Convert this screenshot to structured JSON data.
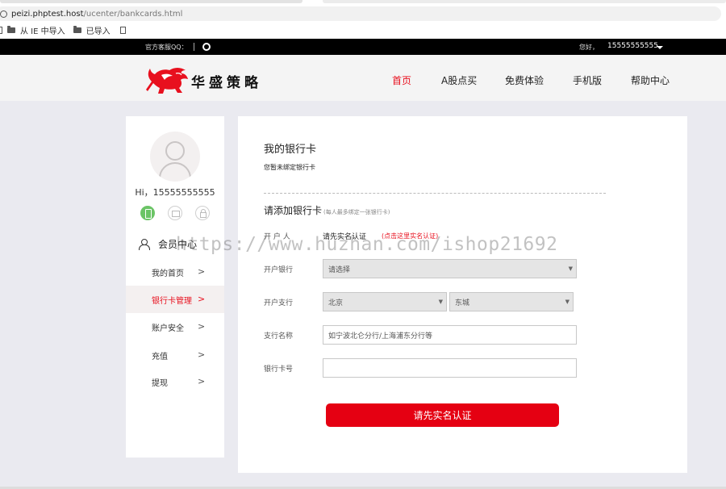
{
  "browser": {
    "url_host": "peizi.phptest.host",
    "url_path": "/ucenter/bankcards.html",
    "bookmarks": [
      "从 IE 中导入",
      "已导入"
    ]
  },
  "topbar": {
    "qq_label": "官方客服QQ：",
    "hello": "您好，",
    "username": "15555555555"
  },
  "header": {
    "brand": "华盛策略",
    "nav": [
      "首页",
      "A股点买",
      "免费体验",
      "手机版",
      "帮助中心"
    ],
    "active_nav": 0
  },
  "sidebar": {
    "greeting": "Hi，15555555555",
    "member_center": "会员中心",
    "menu": [
      {
        "label": "我的首页",
        "chevron": ">"
      },
      {
        "label": "银行卡管理",
        "chevron": ">"
      },
      {
        "label": "账户安全",
        "chevron": ">"
      },
      {
        "label": "充值",
        "chevron": ">"
      },
      {
        "label": "提现",
        "chevron": ">"
      }
    ],
    "active_menu": 1
  },
  "main": {
    "title": "我的银行卡",
    "no_card_text": "您暂未绑定银行卡",
    "add_title": "请添加银行卡",
    "add_hint": "(每人最多绑定一张银行卡)",
    "fields": {
      "owner_label": "开 户 人",
      "owner_value": "请先实名认证",
      "owner_link": "(点击这里实名认证)",
      "bank_label": "开户银行",
      "bank_value": "请选择",
      "branch_label": "开户支行",
      "province_value": "北京",
      "city_value": "东城",
      "branch_name_label": "支行名称",
      "branch_name_placeholder": "如宁波北仑分行/上海浦东分行等",
      "card_no_label": "银行卡号",
      "card_no_value": ""
    },
    "submit_label": "请先实名认证"
  },
  "watermark": "https://www.huzhan.com/ishop21692",
  "colors": {
    "accent_red": "#e8101e",
    "button_red": "#e50012",
    "topbar_black": "#000000"
  }
}
